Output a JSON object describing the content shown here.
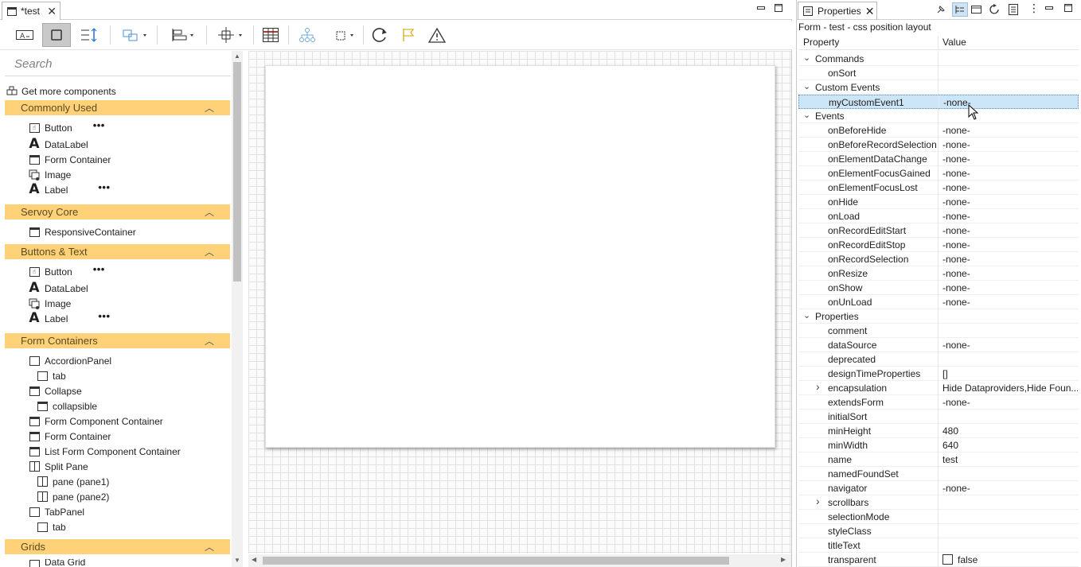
{
  "editor": {
    "tab_label": "*test",
    "win_min": "▭",
    "win_max": "▢"
  },
  "palette": {
    "search_placeholder": "Search",
    "get_more": "Get more components",
    "categories": [
      {
        "label": "Commonly Used",
        "items": [
          "Button",
          "DataLabel",
          "Form Container",
          "Image",
          "Label"
        ]
      },
      {
        "label": "Servoy Core",
        "items": [
          "ResponsiveContainer"
        ]
      },
      {
        "label": "Buttons & Text",
        "items": [
          "Button",
          "DataLabel",
          "Image",
          "Label"
        ]
      },
      {
        "label": "Form Containers",
        "items": [
          "AccordionPanel",
          "tab",
          "Collapse",
          "collapsible",
          "Form Component Container",
          "Form Container",
          "List Form Component Container",
          "Split Pane",
          "pane (pane1)",
          "pane (pane2)",
          "TabPanel",
          "tab"
        ]
      },
      {
        "label": "Grids",
        "items": [
          "Data Grid"
        ]
      }
    ],
    "more_dots": "•••"
  },
  "properties": {
    "tab_label": "Properties",
    "title": "Form - test - css position layout",
    "col_property": "Property",
    "col_value": "Value",
    "rows": [
      {
        "name": "Commands",
        "value": "",
        "group": true
      },
      {
        "name": "onSort",
        "value": ""
      },
      {
        "name": "Custom Events",
        "value": "",
        "group": true
      },
      {
        "name": "myCustomEvent1",
        "value": "-none-",
        "selected": true
      },
      {
        "name": "Events",
        "value": "",
        "group": true
      },
      {
        "name": "onBeforeHide",
        "value": "-none-"
      },
      {
        "name": "onBeforeRecordSelection",
        "value": "-none-"
      },
      {
        "name": "onElementDataChange",
        "value": "-none-"
      },
      {
        "name": "onElementFocusGained",
        "value": "-none-"
      },
      {
        "name": "onElementFocusLost",
        "value": "-none-"
      },
      {
        "name": "onHide",
        "value": "-none-"
      },
      {
        "name": "onLoad",
        "value": "-none-"
      },
      {
        "name": "onRecordEditStart",
        "value": "-none-"
      },
      {
        "name": "onRecordEditStop",
        "value": "-none-"
      },
      {
        "name": "onRecordSelection",
        "value": "-none-"
      },
      {
        "name": "onResize",
        "value": "-none-"
      },
      {
        "name": "onShow",
        "value": "-none-"
      },
      {
        "name": "onUnLoad",
        "value": "-none-"
      },
      {
        "name": "Properties",
        "value": "",
        "group": true
      },
      {
        "name": "comment",
        "value": ""
      },
      {
        "name": "dataSource",
        "value": "-none-"
      },
      {
        "name": "deprecated",
        "value": ""
      },
      {
        "name": "designTimeProperties",
        "value": "[]"
      },
      {
        "name": "encapsulation",
        "value": "Hide Dataproviders,Hide Foun...",
        "collapsed": true
      },
      {
        "name": "extendsForm",
        "value": "-none-"
      },
      {
        "name": "initialSort",
        "value": ""
      },
      {
        "name": "minHeight",
        "value": "480"
      },
      {
        "name": "minWidth",
        "value": "640"
      },
      {
        "name": "name",
        "value": "test"
      },
      {
        "name": "namedFoundSet",
        "value": ""
      },
      {
        "name": "navigator",
        "value": "-none-"
      },
      {
        "name": "scrollbars",
        "value": "",
        "collapsed": true
      },
      {
        "name": "selectionMode",
        "value": ""
      },
      {
        "name": "styleClass",
        "value": ""
      },
      {
        "name": "titleText",
        "value": ""
      },
      {
        "name": "transparent",
        "value": "false",
        "checkbox": true
      }
    ]
  }
}
